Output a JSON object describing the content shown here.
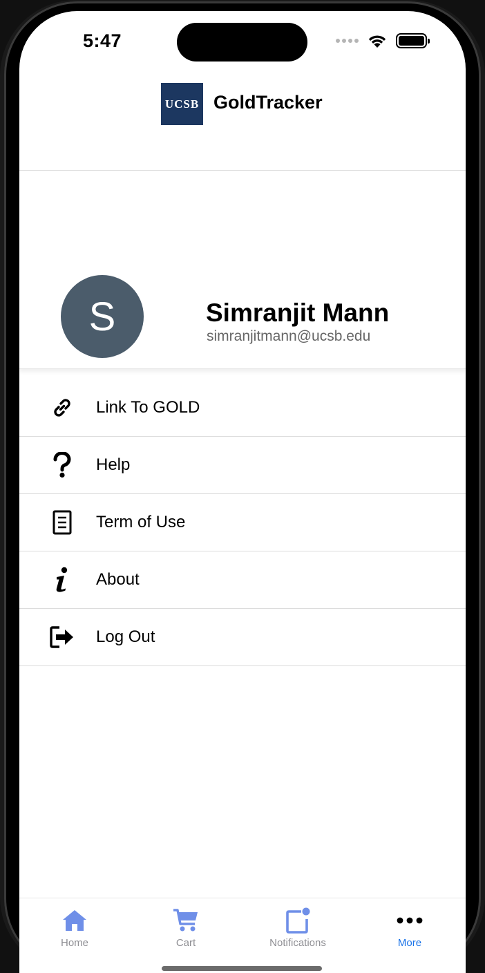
{
  "status_bar": {
    "time": "5:47"
  },
  "header": {
    "logo_text": "UCSB",
    "title": "GoldTracker"
  },
  "profile": {
    "avatar_initial": "S",
    "name": "Simranjit Mann",
    "email": "simranjitmann@ucsb.edu"
  },
  "menu": {
    "items": [
      {
        "label": "Link To GOLD",
        "icon": "link-icon"
      },
      {
        "label": "Help",
        "icon": "question-icon"
      },
      {
        "label": "Term of Use",
        "icon": "document-icon"
      },
      {
        "label": "About",
        "icon": "info-icon"
      },
      {
        "label": "Log Out",
        "icon": "logout-icon"
      }
    ]
  },
  "tabbar": {
    "tabs": [
      {
        "label": "Home",
        "icon": "home-icon",
        "active": false
      },
      {
        "label": "Cart",
        "icon": "cart-icon",
        "active": false
      },
      {
        "label": "Notifications",
        "icon": "notification-icon",
        "active": false
      },
      {
        "label": "More",
        "icon": "more-icon",
        "active": true
      }
    ]
  },
  "colors": {
    "logo_bg": "#1c3760",
    "avatar_bg": "#4b5c6b",
    "tab_icon": "#6f8fe8",
    "tab_active": "#1a73e8"
  }
}
